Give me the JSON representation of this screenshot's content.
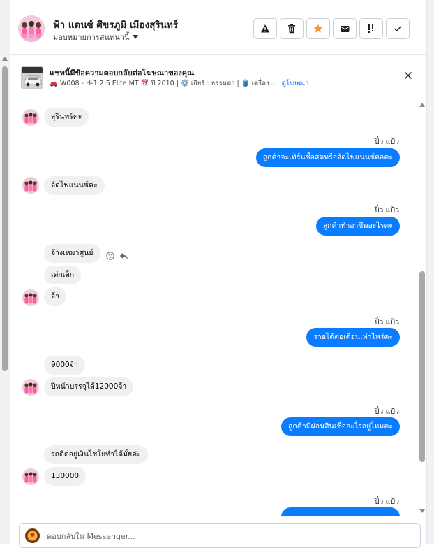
{
  "header": {
    "contact_name": "ฟ้า แดนซ์ ศีขรภูมิ เมืองสุรินทร์",
    "assign_label": "มอบหมายการสนทนานี้",
    "actions": [
      "spam-icon",
      "trash-icon",
      "star-icon",
      "mail-icon",
      "follow-up-icon",
      "check-icon"
    ]
  },
  "ad": {
    "title": "แชทนี้มีข้อความตอบกลับต่อโฆษณาของคุณ",
    "meta": "W008 - H-1 2.5 Elite MT 📅 ปี 2010 | ⚙️ เกียร์ : ธรรมดา | 🛢️ เครื่อง...",
    "link": "ดูโฆษณา"
  },
  "thread": {
    "sender_name": "ปิ๋ว แป้ว",
    "messages": [
      {
        "from": "customer",
        "text": "สุรินทร์ค่ะ"
      },
      {
        "from": "page",
        "text": "ลูกค้าจะเทิร์นชื้อสดหรือจัดไฟแนนซ์ค่อคะ"
      },
      {
        "from": "customer",
        "text": "จัดไฟแนนซ์ค่ะ"
      },
      {
        "from": "page",
        "text": "ลูกค้าทำอาชีพอะไรคะ"
      },
      {
        "from": "customer",
        "text": "จ้างเหมาศูนย์"
      },
      {
        "from": "customer",
        "text": "เด่กเล็ก"
      },
      {
        "from": "customer",
        "text": "จ้า"
      },
      {
        "from": "page",
        "text": "รายได้ต่อเดือนเท่าไหร่คะ"
      },
      {
        "from": "customer",
        "text": "9000จ้า"
      },
      {
        "from": "customer",
        "text": "ปีหน้าบรรจุได้12000จ้า"
      },
      {
        "from": "page",
        "text": "ลูกค้ามีผ่อนสินเชื่ออะไรอยู่ไหมคะ"
      },
      {
        "from": "customer",
        "text": "รถติดอยู่เงินไชโยทำได้มั้ยค่ะ"
      },
      {
        "from": "customer",
        "text": "130000"
      }
    ]
  },
  "composer": {
    "placeholder": "ตอบกลับใน Messenger..."
  },
  "colors": {
    "accent": "#0a7cff",
    "incoming_bubble": "#f0f0f0",
    "link": "#0866ff"
  }
}
